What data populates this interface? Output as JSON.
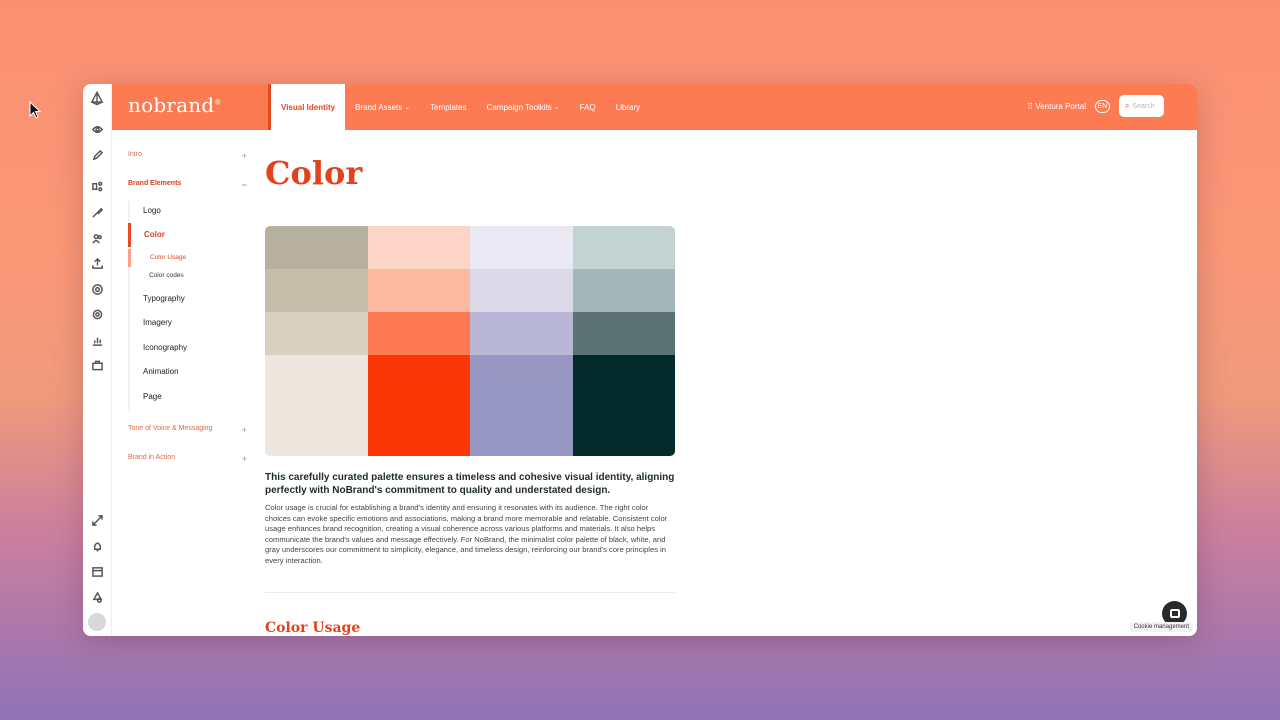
{
  "app": {
    "brand": "nobrand",
    "brand_mark": "®"
  },
  "topbar": {
    "nav": [
      {
        "label": "Visual Identity",
        "active": true,
        "dropdown": false
      },
      {
        "label": "Brand Assets",
        "active": false,
        "dropdown": true
      },
      {
        "label": "Templates",
        "active": false,
        "dropdown": false
      },
      {
        "label": "Campaign Toolkits",
        "active": false,
        "dropdown": true
      },
      {
        "label": "FAQ",
        "active": false,
        "dropdown": false
      },
      {
        "label": "Library",
        "active": false,
        "dropdown": false
      }
    ],
    "portal": "Ventura Portal",
    "lang": "EN",
    "search_placeholder": "Search"
  },
  "sidebar": {
    "sections": [
      {
        "label": "Intro",
        "toggle": "+"
      },
      {
        "label": "Brand Elements",
        "toggle": "−"
      },
      {
        "label": "Tone of Voice & Messaging",
        "toggle": "+"
      },
      {
        "label": "Brand in Action",
        "toggle": "+"
      }
    ],
    "items": [
      {
        "label": "Logo"
      },
      {
        "label": "Color"
      },
      {
        "label": "Typography"
      },
      {
        "label": "Imagery"
      },
      {
        "label": "Iconography"
      },
      {
        "label": "Animation"
      },
      {
        "label": "Page"
      }
    ],
    "subitems": [
      {
        "label": "Color Usage"
      },
      {
        "label": "Color codes"
      }
    ]
  },
  "main": {
    "title": "Color",
    "lead": "This carefully curated palette ensures a timeless and cohesive visual identity, aligning perfectly with NoBrand's commitment to quality and understated design.",
    "body": "Color usage is crucial for establishing a brand's identity and ensuring it resonates with its audience. The right color choices can evoke specific emotions and associations, making a brand more memorable and relatable. Consistent color usage enhances brand recognition, creating a visual coherence across various platforms and materials. It also helps communicate the brand's values and message effectively. For NoBrand, the minimalist color palette of black, white, and gray underscores our commitment to simplicity, elegance, and timeless design, reinforcing our brand's core principles in every interaction.",
    "section_heading": "Color Usage",
    "palette": [
      [
        "#b8b09f",
        "#c6bdab",
        "#d8d1c2",
        "#ede8df"
      ],
      [
        "#fdd5c6",
        "#fdb9a2",
        "#fd7a54",
        "#fb3707"
      ],
      [
        "#e9e8f4",
        "#dcdae9",
        "#b9b6d6",
        "#9897c4"
      ],
      [
        "#c3d3d2",
        "#a4b6b7",
        "#5c7273",
        "#022a2a"
      ]
    ]
  },
  "footer": {
    "cookie": "Cookie management"
  },
  "colors": {
    "accent": "#fd7b52",
    "heading": "#e2431c"
  }
}
